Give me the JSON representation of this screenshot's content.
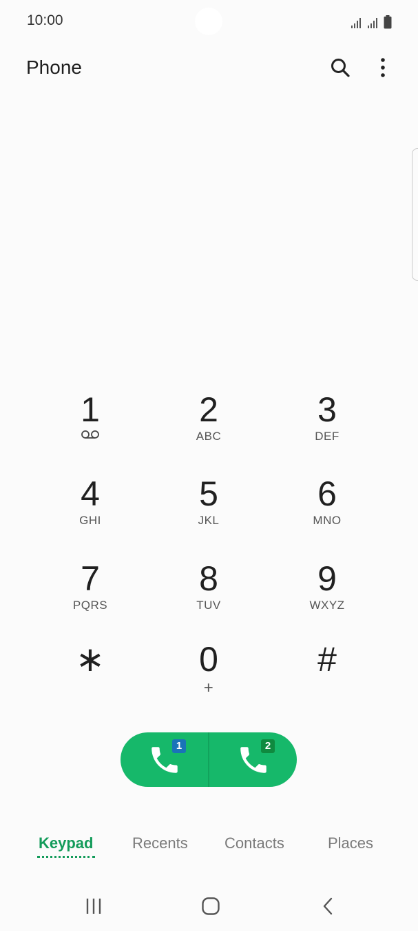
{
  "status_bar": {
    "time": "10:00",
    "icons": [
      "signal-sim1-icon",
      "signal-sim2-icon",
      "battery-icon"
    ]
  },
  "app_bar": {
    "title": "Phone",
    "actions": [
      "search-icon",
      "more-options-icon"
    ]
  },
  "keypad": {
    "keys": [
      {
        "digit": "1",
        "sub": "",
        "sub_icon": "voicemail-icon"
      },
      {
        "digit": "2",
        "sub": "ABC"
      },
      {
        "digit": "3",
        "sub": "DEF"
      },
      {
        "digit": "4",
        "sub": "GHI"
      },
      {
        "digit": "5",
        "sub": "JKL"
      },
      {
        "digit": "6",
        "sub": "MNO"
      },
      {
        "digit": "7",
        "sub": "PQRS"
      },
      {
        "digit": "8",
        "sub": "TUV"
      },
      {
        "digit": "9",
        "sub": "WXYZ"
      },
      {
        "digit": "∗",
        "sub": ""
      },
      {
        "digit": "0",
        "sub": "+"
      },
      {
        "digit": "#",
        "sub": ""
      }
    ]
  },
  "call_buttons": {
    "sim1_badge": "1",
    "sim2_badge": "2",
    "sim1_color": "#1a73b8",
    "sim2_color": "#0f8a3f",
    "button_color": "#16b86a"
  },
  "tabs": [
    {
      "label": "Keypad",
      "active": true
    },
    {
      "label": "Recents",
      "active": false
    },
    {
      "label": "Contacts",
      "active": false
    },
    {
      "label": "Places",
      "active": false
    }
  ],
  "accent_color": "#139b5a",
  "nav_bar": [
    "recent-apps-icon",
    "home-icon",
    "back-icon"
  ]
}
